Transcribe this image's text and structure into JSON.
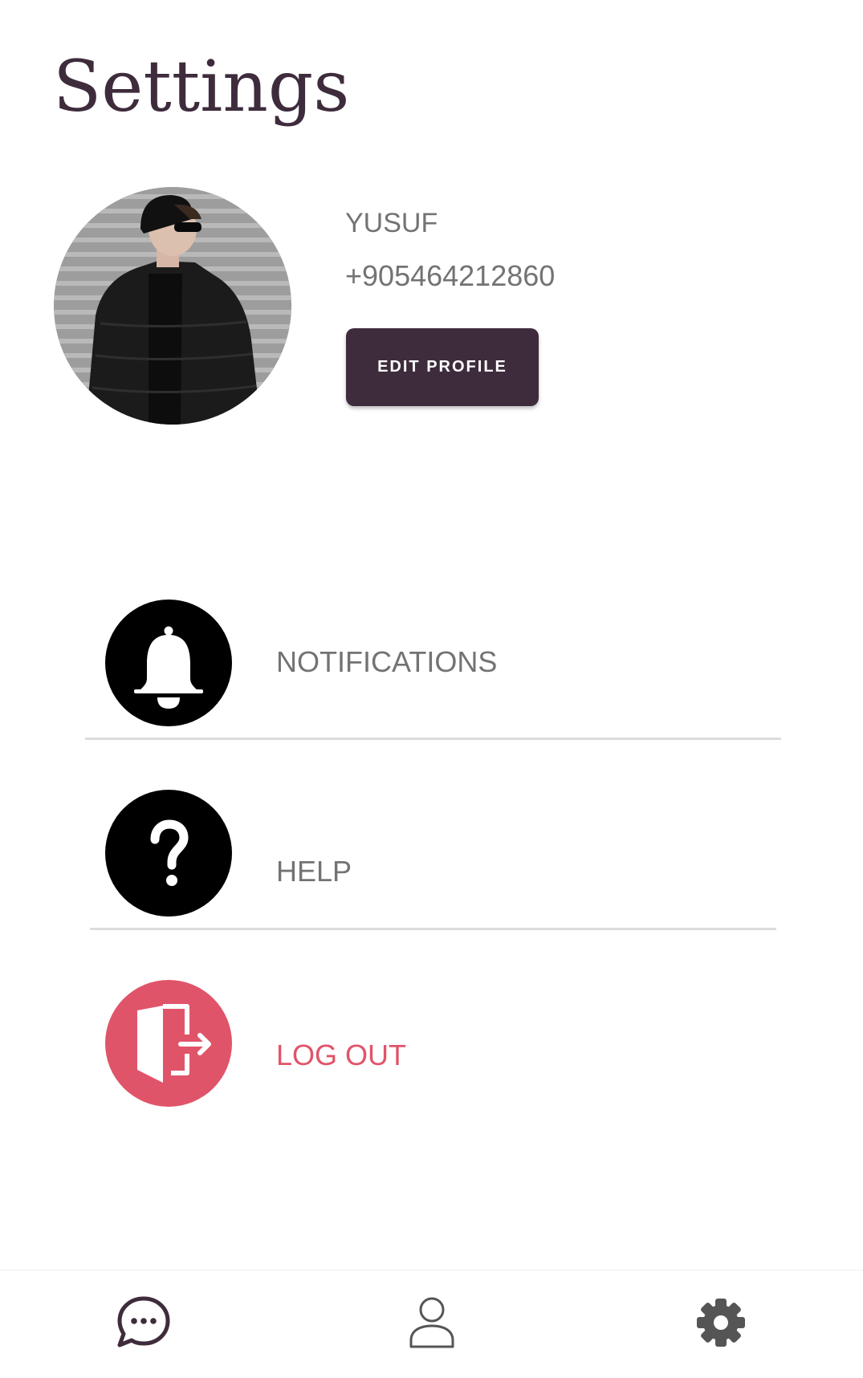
{
  "page": {
    "title": "Settings"
  },
  "profile": {
    "name": "YUSUF",
    "phone": "+905464212860",
    "edit_button_label": "EDIT PROFILE",
    "avatar_icon": "profile-photo"
  },
  "menu": {
    "items": [
      {
        "label": "NOTIFICATIONS",
        "icon": "bell-icon"
      },
      {
        "label": "HELP",
        "icon": "question-mark-icon"
      },
      {
        "label": "LOG OUT",
        "icon": "exit-door-icon"
      }
    ]
  },
  "bottom_nav": {
    "items": [
      {
        "icon": "chat-bubble-icon",
        "active": false
      },
      {
        "icon": "person-icon",
        "active": false
      },
      {
        "icon": "gear-icon",
        "active": true
      }
    ]
  },
  "colors": {
    "primary": "#3e2c3c",
    "text_secondary": "#737373",
    "logout": "#e0546a",
    "icon_circle": "#000000",
    "divider": "#dcdcdc",
    "nav_active": "#555555"
  }
}
